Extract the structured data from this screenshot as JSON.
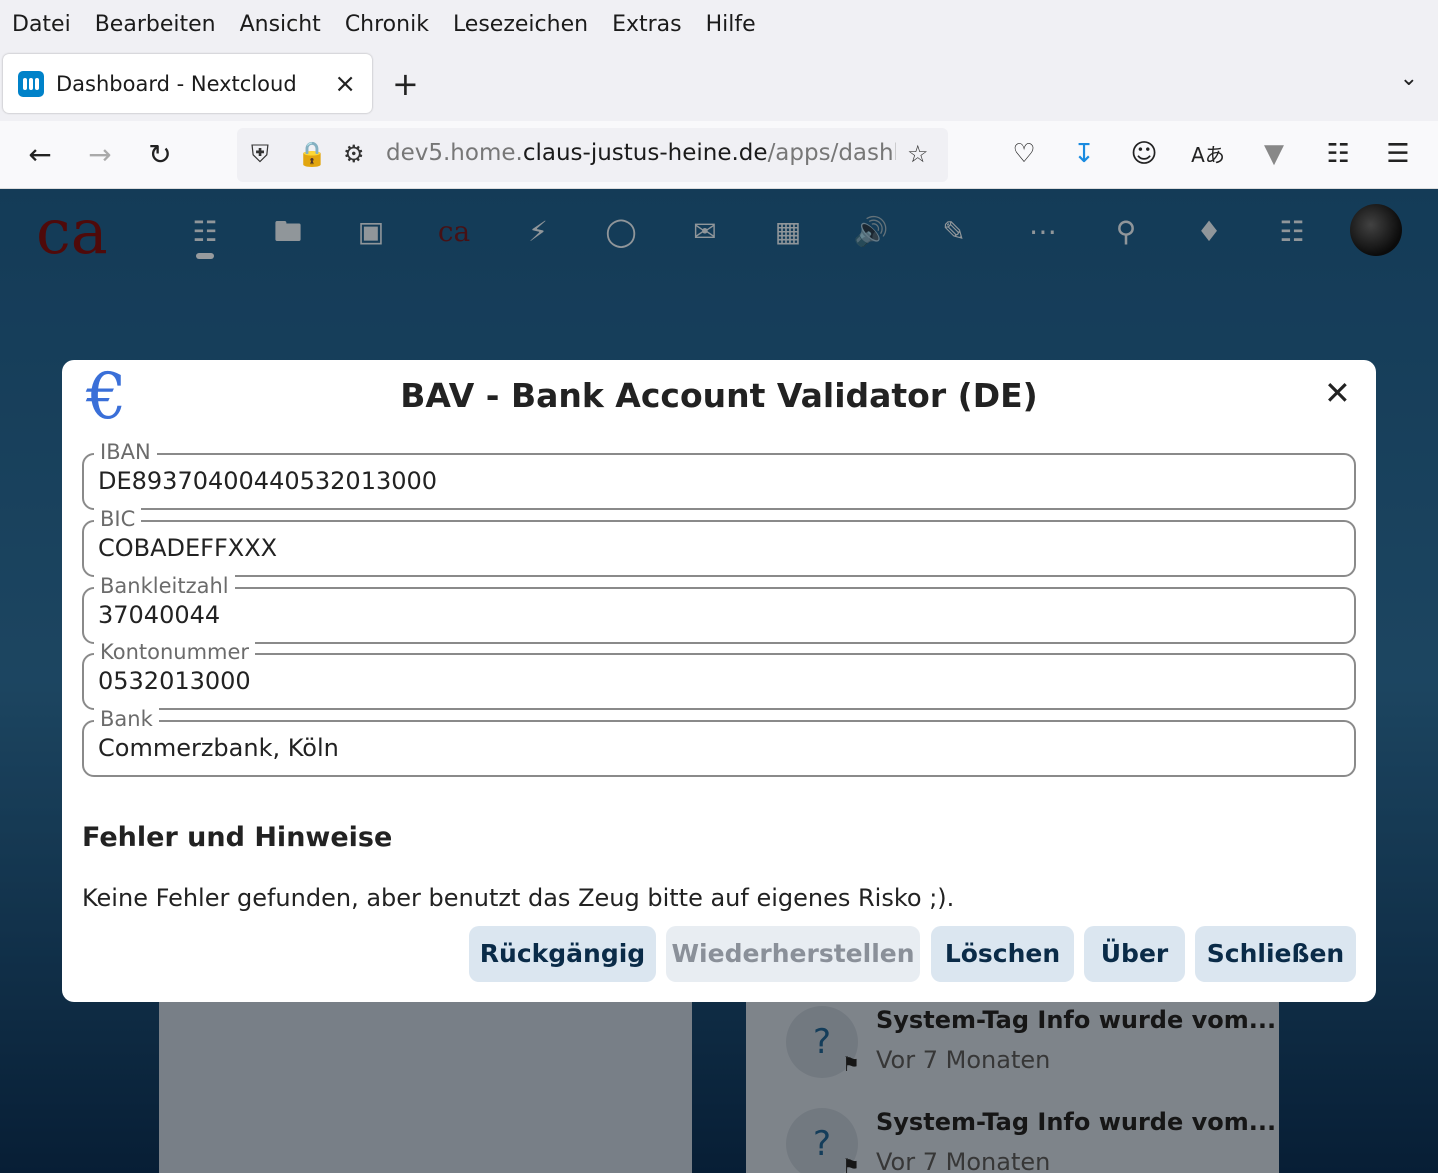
{
  "menu": [
    "Datei",
    "Bearbeiten",
    "Ansicht",
    "Chronik",
    "Lesezeichen",
    "Extras",
    "Hilfe"
  ],
  "tab": {
    "title": "Dashboard - Nextcloud",
    "close": "×"
  },
  "url": {
    "prefix": "dev5.home.",
    "domain": "claus-justus-heine.de",
    "path": "/apps/dashbo"
  },
  "dialog": {
    "title": "BAV - Bank Account Validator (DE)",
    "fields": [
      {
        "label": "IBAN",
        "value": "DE89370400440532013000"
      },
      {
        "label": "BIC",
        "value": "COBADEFFXXX"
      },
      {
        "label": "Bankleitzahl",
        "value": "37040044"
      },
      {
        "label": "Kontonummer",
        "value": "0532013000"
      },
      {
        "label": "Bank",
        "value": "Commerzbank, Köln"
      }
    ],
    "section": "Fehler und Hinweise",
    "note": "Keine Fehler gefunden, aber benutzt das Zeug bitte auf eigenes Risko ;).",
    "buttons": {
      "undo": "Rückgängig",
      "redo": "Wiederherstellen",
      "delete": "Löschen",
      "about": "Über",
      "close": "Schließen"
    }
  },
  "activity": [
    {
      "text": "System-Tag Info wurde vom...",
      "time": "Vor 7 Monaten"
    },
    {
      "text": "System-Tag Info wurde vom...",
      "time": "Vor 7 Monaten"
    }
  ]
}
